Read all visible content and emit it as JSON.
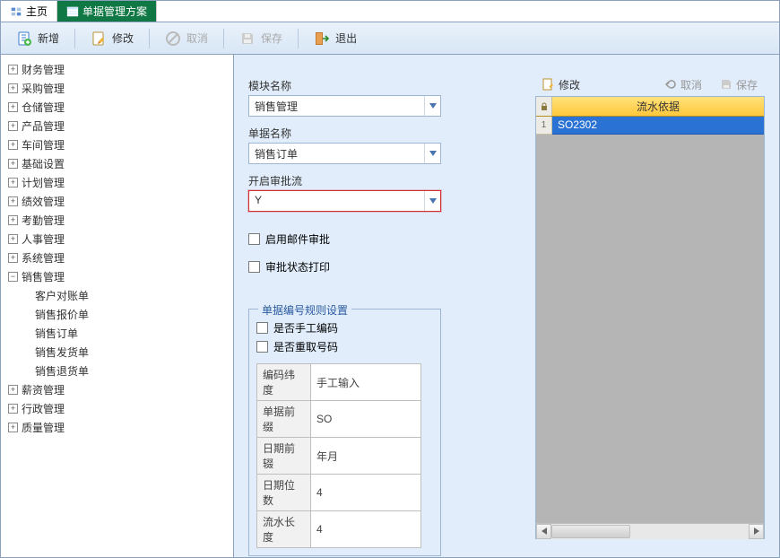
{
  "tabs": {
    "home": "主页",
    "active": "单据管理方案"
  },
  "toolbar": {
    "add": "新增",
    "edit": "修改",
    "cancel": "取消",
    "save": "保存",
    "exit": "退出"
  },
  "tree": {
    "items": [
      {
        "label": "财务管理"
      },
      {
        "label": "采购管理"
      },
      {
        "label": "仓储管理"
      },
      {
        "label": "产品管理"
      },
      {
        "label": "车间管理"
      },
      {
        "label": "基础设置"
      },
      {
        "label": "计划管理"
      },
      {
        "label": "绩效管理"
      },
      {
        "label": "考勤管理"
      },
      {
        "label": "人事管理"
      },
      {
        "label": "系统管理"
      },
      {
        "label": "销售管理",
        "expanded": true,
        "children": [
          {
            "label": "客户对账单"
          },
          {
            "label": "销售报价单"
          },
          {
            "label": "销售订单"
          },
          {
            "label": "销售发货单"
          },
          {
            "label": "销售退货单"
          }
        ]
      },
      {
        "label": "薪资管理"
      },
      {
        "label": "行政管理"
      },
      {
        "label": "质量管理"
      }
    ]
  },
  "form": {
    "module_label": "模块名称",
    "module_value": "销售管理",
    "doc_label": "单据名称",
    "doc_value": "销售订单",
    "approval_label": "开启审批流",
    "approval_value": "Y",
    "chk_mail": "启用邮件审批",
    "chk_print": "审批状态打印",
    "fieldset_title": "单据编号规则设置",
    "chk_manual": "是否手工编码",
    "chk_regen": "是否重取号码",
    "kv": [
      {
        "k": "编码纬度",
        "v": "手工输入"
      },
      {
        "k": "单据前缀",
        "v": "SO"
      },
      {
        "k": "日期前辍",
        "v": "年月"
      },
      {
        "k": "日期位数",
        "v": "4"
      },
      {
        "k": "流水长度",
        "v": "4"
      }
    ]
  },
  "grid": {
    "toolbar": {
      "edit": "修改",
      "cancel": "取消",
      "save": "保存"
    },
    "header": "流水依据",
    "rows": [
      {
        "idx": "1",
        "val": "SO2302"
      }
    ]
  }
}
